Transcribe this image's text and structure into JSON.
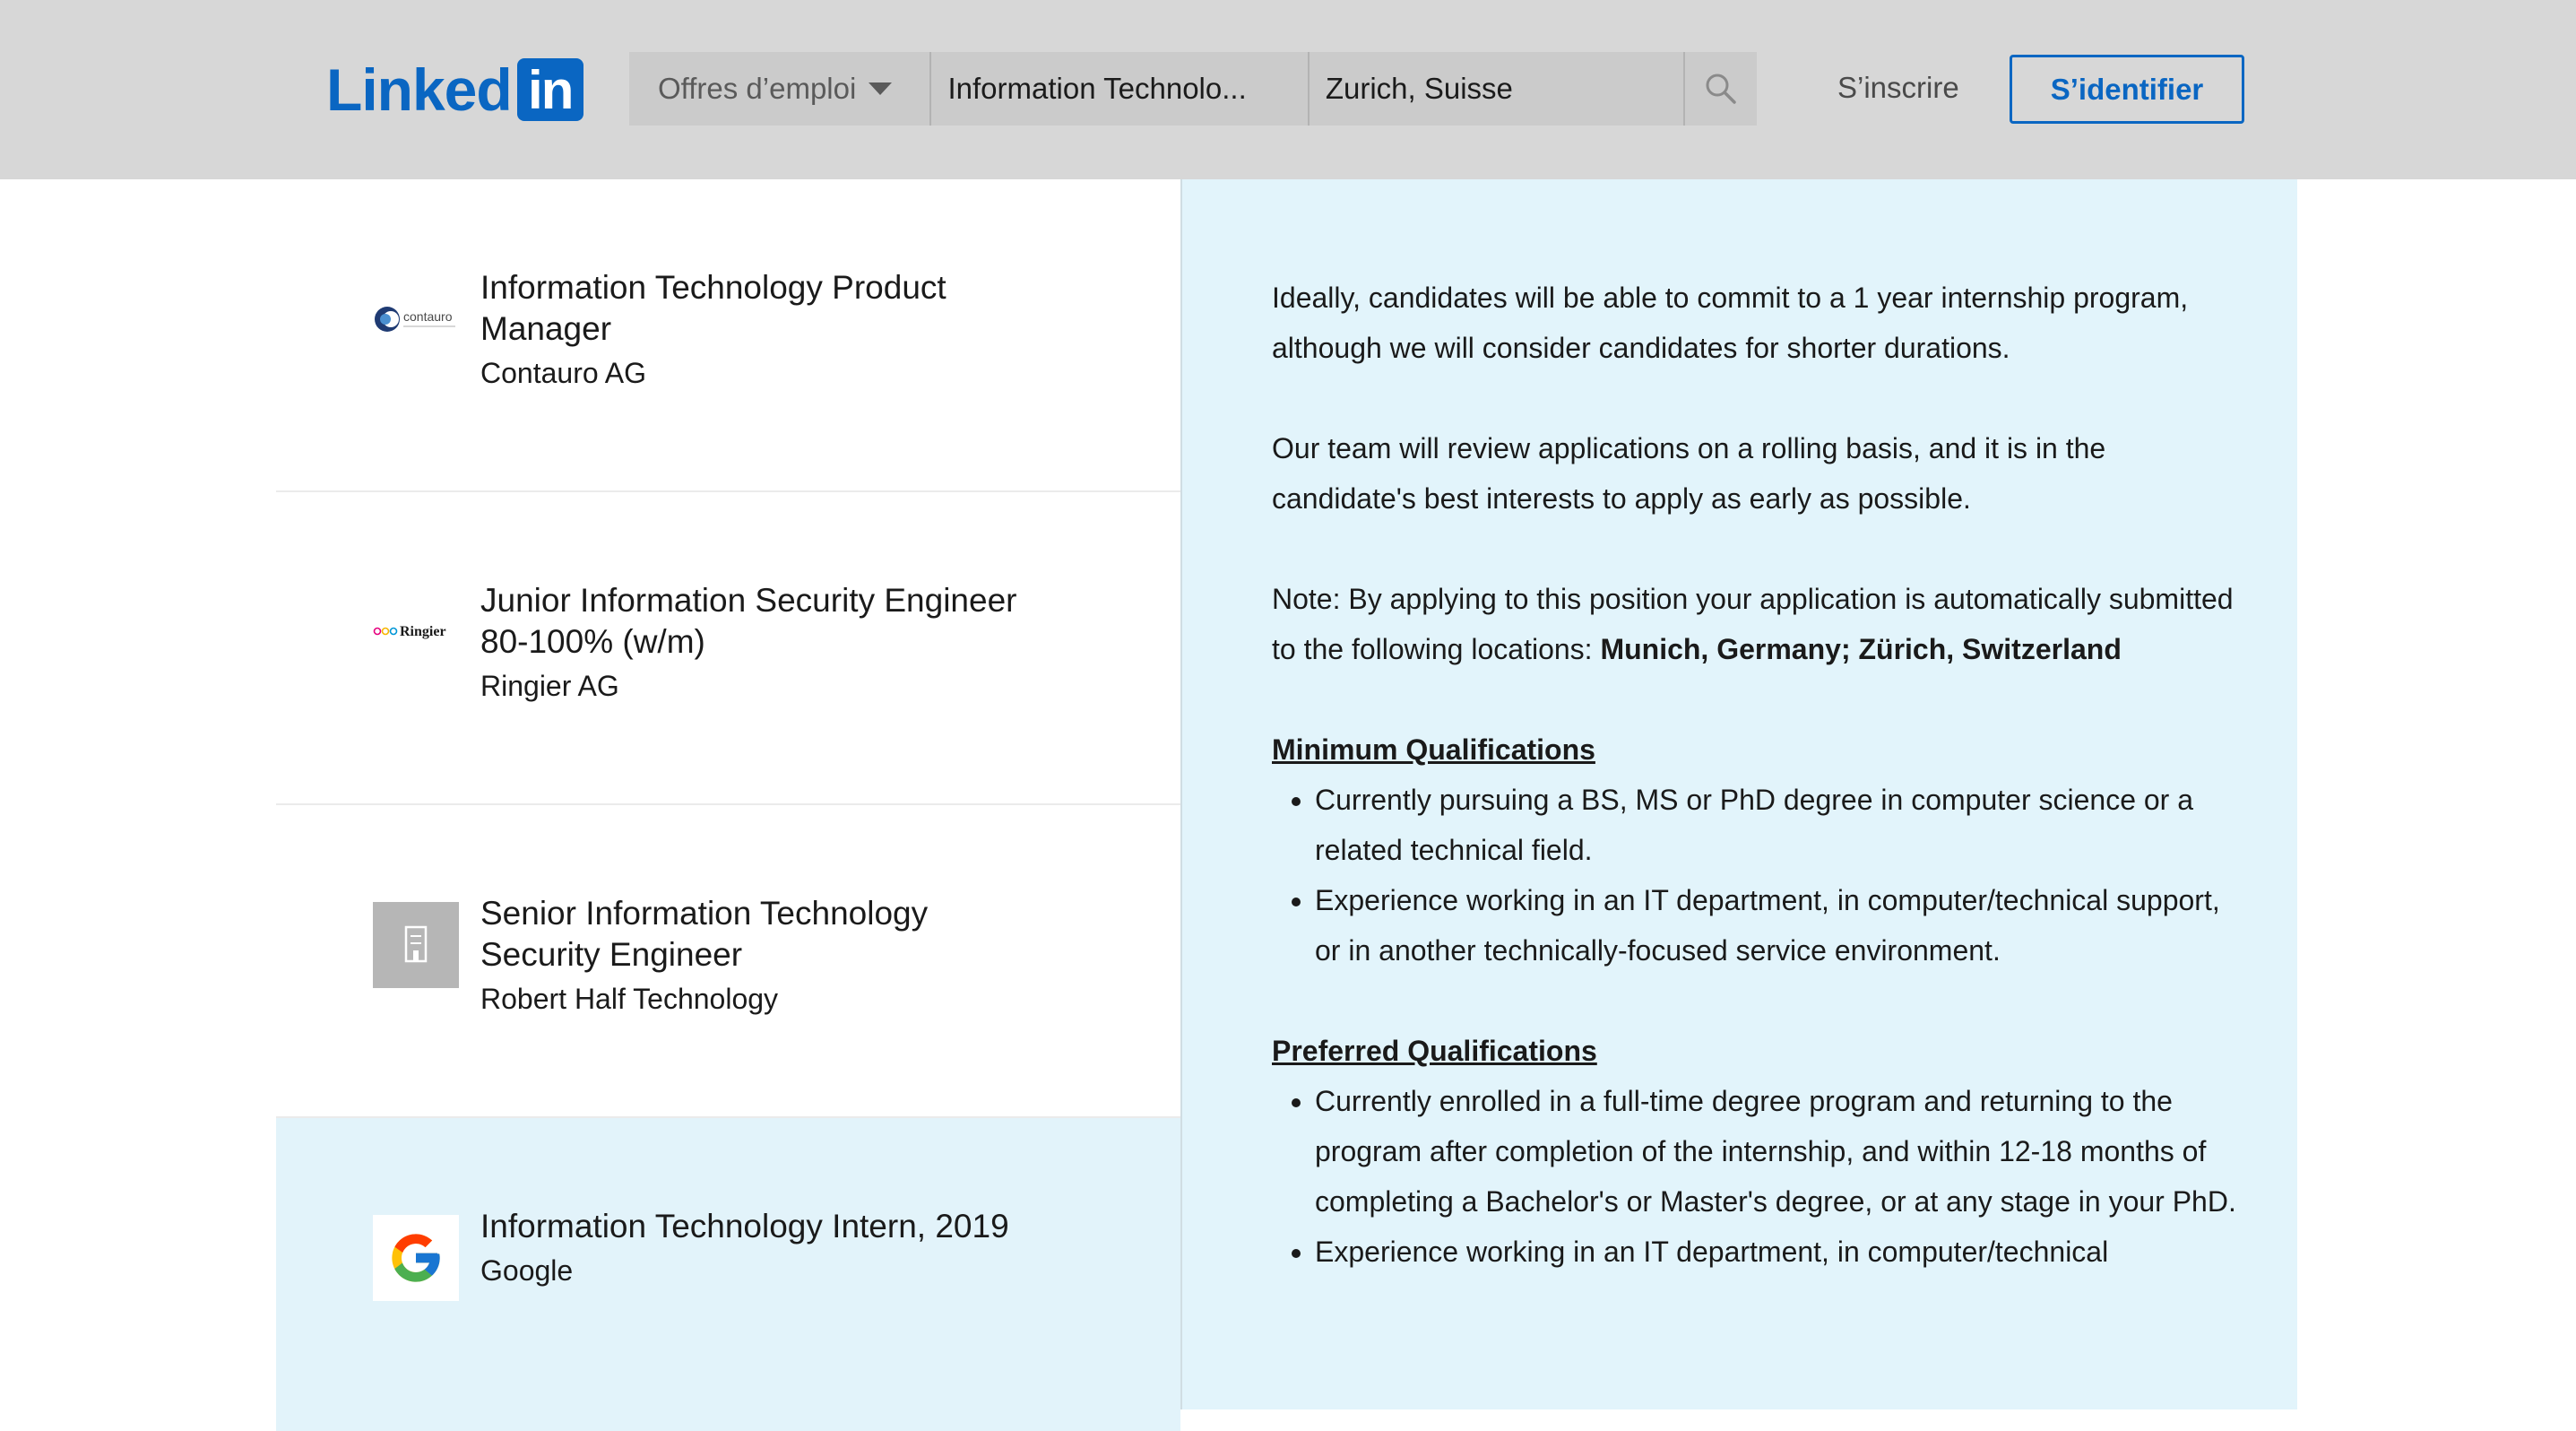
{
  "header": {
    "logo_text": "Linked",
    "logo_in": "in",
    "jobs_dropdown_label": "Offres d’emploi",
    "keywords_value": "Information Technolo...",
    "location_value": "Zurich, Suisse",
    "signup_label": "S’inscrire",
    "signin_label": "S’identifier",
    "brand_color": "#0a66c2"
  },
  "results": [
    {
      "title": "Information Technology Product Manager",
      "company": "Contauro AG",
      "logo": "contauro-logo",
      "logo_text": "contauro"
    },
    {
      "title": "Junior Information Security Engineer 80-100% (w/m)",
      "company": "Ringier AG",
      "logo": "ringier-logo",
      "logo_text": "Ringier"
    },
    {
      "title": "Senior Information Technology Security Engineer",
      "company": "Robert Half Technology",
      "logo": "building-placeholder-icon"
    },
    {
      "title": "Information Technology Intern, 2019",
      "company": "Google",
      "logo": "google-logo",
      "selected": true
    }
  ],
  "description": {
    "para1": "Ideally, candidates will be able to commit to a 1 year internship program, although we will consider candidates for shorter durations.",
    "para2": "Our team will review applications on a rolling basis, and it is in the candidate's best interests to apply as early as possible.",
    "para3_prefix": "Note: By applying to this position your application is automatically submitted to the following locations: ",
    "para3_locations": "Munich, Germany; Zürich, Switzerland",
    "min_heading": "Minimum Qualifications",
    "min_items": [
      "Currently pursuing a BS, MS or PhD degree in computer science or a related technical field.",
      "Experience working in an IT department, in computer/technical support, or in another technically-focused service environment."
    ],
    "pref_heading": "Preferred Qualifications",
    "pref_items": [
      "Currently enrolled in a full-time degree program and returning to the program after completion of the internship, and within 12-18 months of completing a Bachelor's or Master's degree, or at any stage in your PhD.",
      "Experience working in an IT department, in computer/technical"
    ]
  }
}
